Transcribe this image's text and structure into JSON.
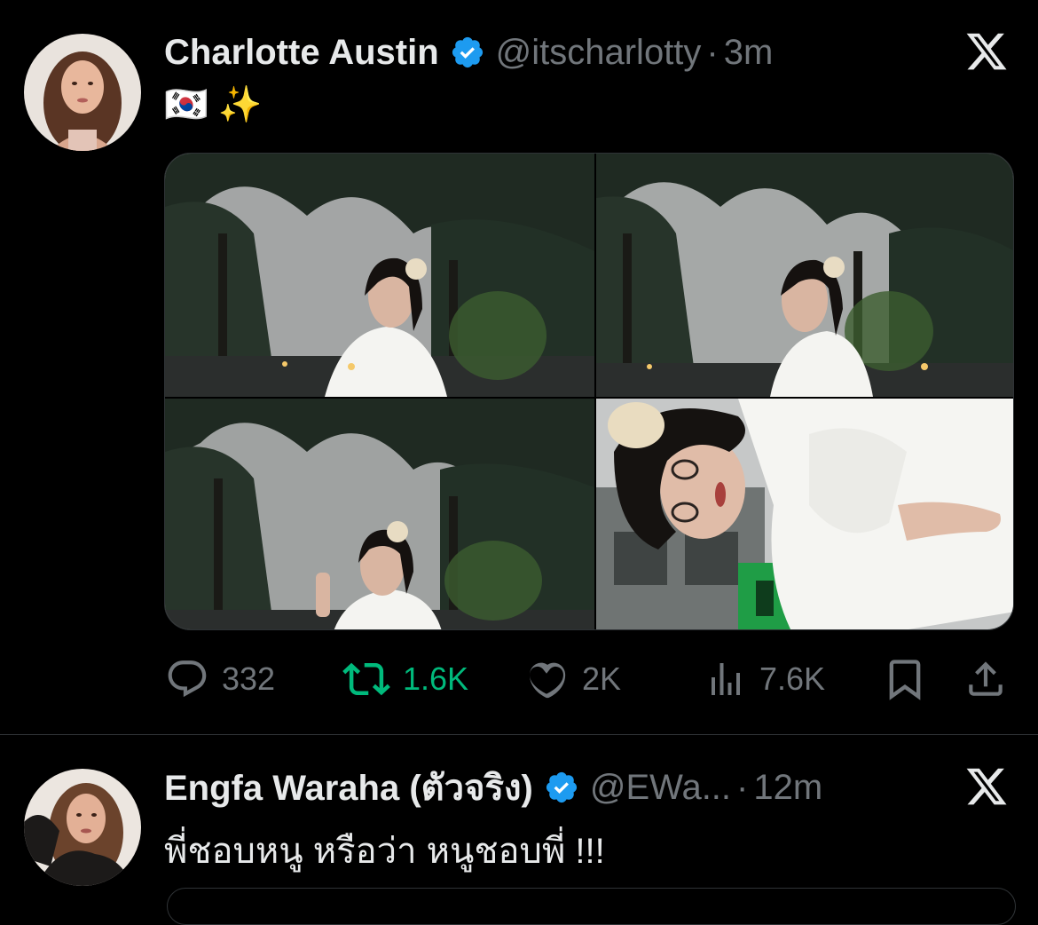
{
  "tweets": [
    {
      "display_name": "Charlotte Austin",
      "handle": "@itscharlotty",
      "separator": "·",
      "time": "3m",
      "text": "🇰🇷 ✨",
      "avatar": "avatar-photo",
      "verified_icon": "verified-badge-icon",
      "platform_icon": "x-logo-icon",
      "media": [
        {
          "alt": "photo-1-trees-woman-glasses"
        },
        {
          "alt": "photo-2-trees-woman-glasses"
        },
        {
          "alt": "photo-3-trees-woman-adjusting-glasses"
        },
        {
          "alt": "photo-4-closeup-woman-white-shirt"
        }
      ],
      "actions": {
        "replies": "332",
        "reposts": "1.6K",
        "likes": "2K",
        "views": "7.6K"
      },
      "colors": {
        "repost_active": "#00ba7c",
        "verified": "#1d9bf0",
        "muted": "#71767b"
      }
    },
    {
      "display_name": "Engfa Waraha (ตัวจริง)",
      "handle": "@EWa...",
      "separator": "·",
      "time": "12m",
      "text": "พี่ชอบหนู หรือว่า หนูชอบพี่ !!!",
      "avatar": "avatar-photo",
      "verified_icon": "verified-badge-icon",
      "platform_icon": "x-logo-icon"
    }
  ]
}
